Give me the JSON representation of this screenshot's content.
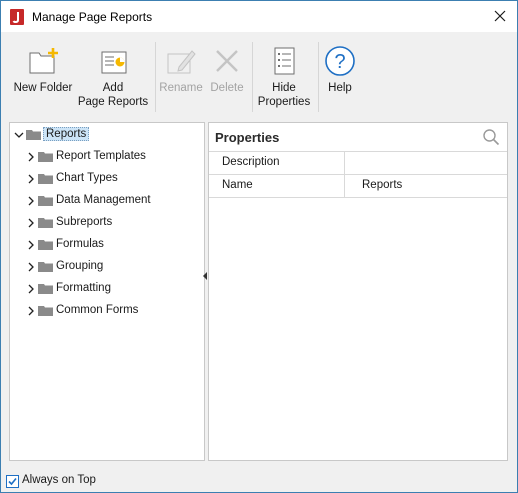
{
  "window": {
    "title": "Manage Page Reports"
  },
  "toolbar": {
    "new_folder": "New Folder",
    "add_page_reports_line1": "Add",
    "add_page_reports_line2": "Page Reports",
    "rename": "Rename",
    "delete": "Delete",
    "hide_properties_line1": "Hide",
    "hide_properties_line2": "Properties",
    "help": "Help"
  },
  "tree": {
    "root": "Reports",
    "children": [
      "Report Templates",
      "Chart Types",
      "Data Management",
      "Subreports",
      "Formulas",
      "Grouping",
      "Formatting",
      "Common Forms"
    ]
  },
  "properties": {
    "title": "Properties",
    "rows": [
      {
        "name": "Description",
        "value": ""
      },
      {
        "name": "Name",
        "value": "Reports"
      }
    ]
  },
  "footer": {
    "always_on_top_label": "Always on Top",
    "always_on_top_checked": true
  },
  "colors": {
    "accent": "#1e6fc4",
    "folder": "#8a8a8a",
    "new_folder_star": "#f5b800",
    "app_icon": "#c62828"
  }
}
